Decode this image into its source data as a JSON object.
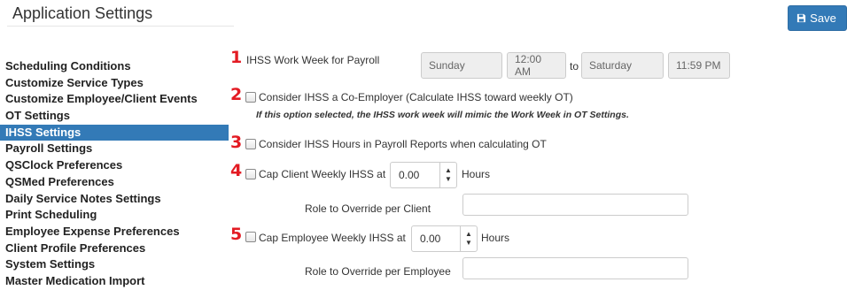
{
  "header": {
    "title": "Application Settings",
    "save_label": "Save"
  },
  "sidebar": {
    "items": [
      {
        "label": "Scheduling Conditions",
        "active": false
      },
      {
        "label": "Customize Service Types",
        "active": false
      },
      {
        "label": "Customize Employee/Client Events",
        "active": false
      },
      {
        "label": "OT Settings",
        "active": false
      },
      {
        "label": "IHSS Settings",
        "active": true
      },
      {
        "label": "Payroll Settings",
        "active": false
      },
      {
        "label": "QSClock Preferences",
        "active": false
      },
      {
        "label": "QSMed Preferences",
        "active": false
      },
      {
        "label": "Daily Service Notes Settings",
        "active": false
      },
      {
        "label": "Print Scheduling",
        "active": false
      },
      {
        "label": "Employee Expense Preferences",
        "active": false
      },
      {
        "label": "Client Profile Preferences",
        "active": false
      },
      {
        "label": "System Settings",
        "active": false
      },
      {
        "label": "Master Medication Import",
        "active": false
      }
    ]
  },
  "settings": {
    "work_week": {
      "number": "1",
      "label": "IHSS Work Week for Payroll",
      "start_day": "Sunday",
      "start_time": "12:00 AM",
      "to_label": "to",
      "end_day": "Saturday",
      "end_time": "11:59 PM"
    },
    "co_employer": {
      "number": "2",
      "label": "Consider IHSS a Co-Employer (Calculate IHSS toward weekly OT)",
      "note": "If this option selected, the IHSS work week will mimic the Work Week in OT Settings.",
      "checked": false
    },
    "payroll_reports": {
      "number": "3",
      "label": "Consider IHSS Hours in Payroll Reports when calculating OT",
      "checked": false
    },
    "cap_client": {
      "number": "4",
      "label": "Cap Client Weekly IHSS at",
      "value": "0.00",
      "unit": "Hours",
      "role_label": "Role to Override per Client",
      "role_value": "",
      "checked": false
    },
    "cap_employee": {
      "number": "5",
      "label": "Cap Employee Weekly IHSS at",
      "value": "0.00",
      "unit": "Hours",
      "role_label": "Role to Override per Employee",
      "role_value": "",
      "checked": false
    }
  },
  "colors": {
    "primary": "#337ab7",
    "number_red": "#e31b23"
  }
}
